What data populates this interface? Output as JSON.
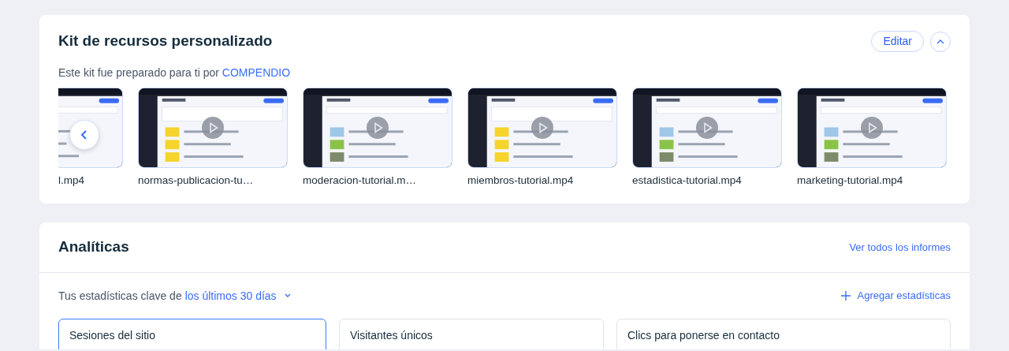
{
  "kit": {
    "title": "Kit de recursos personalizado",
    "edit_button": "Editar",
    "expanded": true,
    "intro": "Este kit fue preparado para ti por",
    "author": "COMPENDIO",
    "videos": [
      {
        "name": "l.mp4",
        "partial": true
      },
      {
        "name": "normas-publicacion-tu…",
        "partial": false
      },
      {
        "name": "moderacion-tutorial.m…",
        "partial": false
      },
      {
        "name": "miembros-tutorial.mp4",
        "partial": false
      },
      {
        "name": "estadistica-tutorial.mp4",
        "partial": false
      },
      {
        "name": "marketing-tutorial.mp4",
        "partial": false
      }
    ]
  },
  "analytics": {
    "title": "Analíticas",
    "all_reports": "Ver todos los informes",
    "period_label": "Tus estadísticas clave de",
    "period": "los últimos 30 días",
    "add_stats": "Agregar estadísticas",
    "stats": [
      {
        "title": "Sesiones del sitio",
        "selected": true
      },
      {
        "title": "Visitantes únicos",
        "selected": false
      },
      {
        "title": "Clics para ponerse en contacto",
        "selected": false
      }
    ]
  }
}
